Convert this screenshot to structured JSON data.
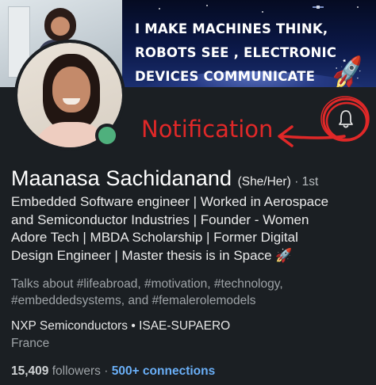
{
  "banner": {
    "lines": [
      "I MAKE  MACHINES THINK,",
      "ROBOTS SEE , ELECTRONIC",
      "DEVICES COMMUNICATE"
    ]
  },
  "annotation": {
    "label": "Notification",
    "color": "#e02828"
  },
  "profile": {
    "name": "Maanasa Sachidanand",
    "pronouns": "(She/Her)",
    "degree": "· 1st",
    "headline_lines": [
      "Embedded Software engineer | Worked in Aerospace",
      "and Semiconductor Industries | Founder - Women",
      "Adore Tech |  MBDA Scholarship | Former Digital",
      "Design Engineer |  Master thesis is in Space 🚀"
    ],
    "talks_lines": [
      "Talks about #lifeabroad, #motivation, #technology,",
      "#embeddedsystems, and #femalerolemodels"
    ],
    "company": "NXP Semiconductors • ISAE-SUPAERO",
    "location": "France",
    "followers_count": "15,409",
    "followers_label": "followers",
    "separator": "·",
    "connections": "500+ connections"
  },
  "icons": {
    "bell": "bell-icon",
    "online": "online-status-icon",
    "rocket": "rocket-icon"
  },
  "colors": {
    "background": "#1b1f23",
    "link": "#6aaff7",
    "online": "#4fb07d"
  }
}
